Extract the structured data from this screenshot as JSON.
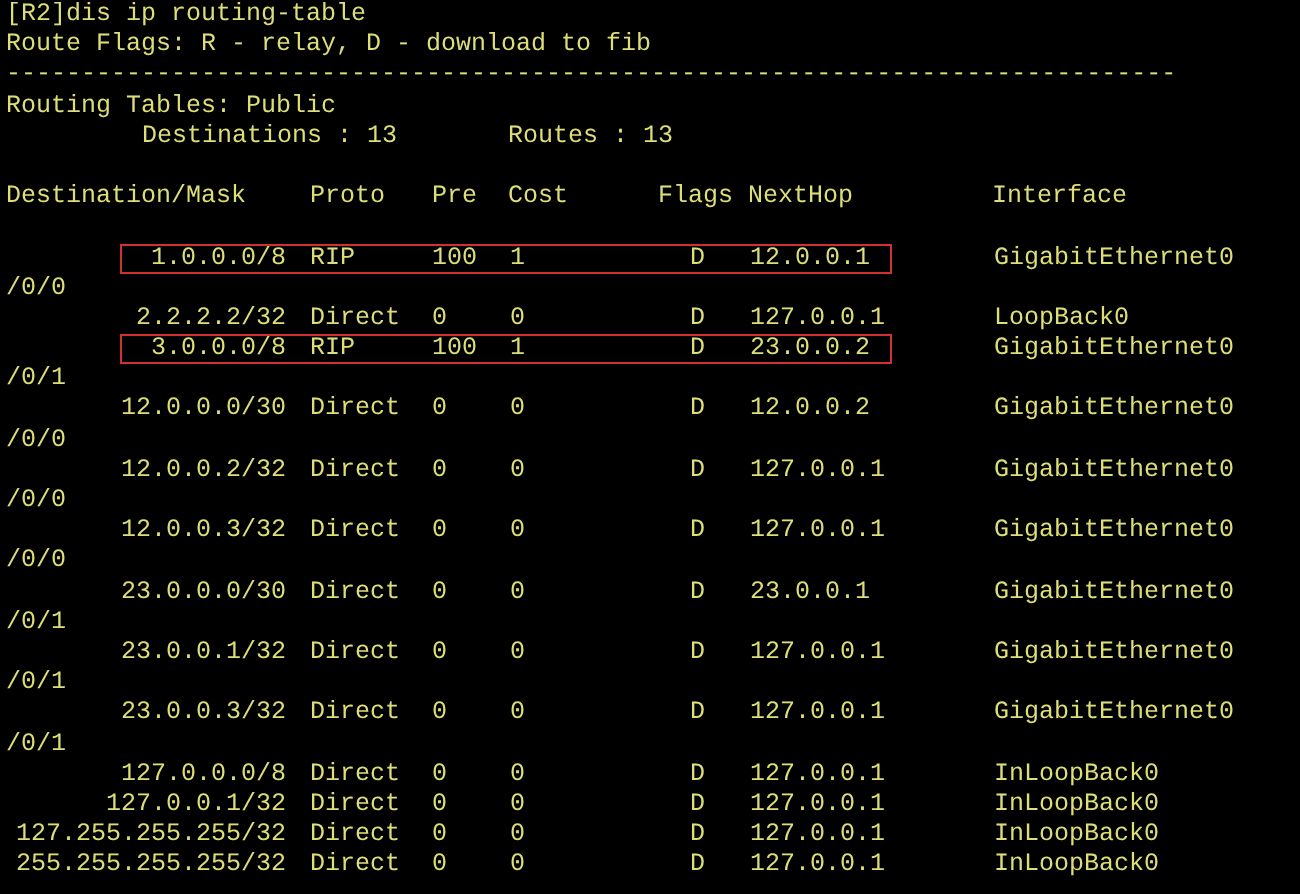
{
  "terminal": {
    "command": "[R2]dis ip routing-table",
    "flags_legend": "Route Flags: R - relay, D - download to fib",
    "separator": "------------------------------------------------------------------------------",
    "table_name": "Routing Tables: Public",
    "destinations": "Destinations : 13",
    "routes": "Routes : 13"
  },
  "columns": [
    "Destination/Mask",
    "Proto",
    "Pre",
    "Cost",
    "Flags",
    "NextHop",
    "Interface"
  ],
  "rows": [
    {
      "destination": "1.0.0.0/8",
      "proto": "RIP",
      "pre": "100",
      "cost": "1",
      "flags": "D",
      "nexthop": "12.0.0.1",
      "interface": "GigabitEthernet0",
      "interface_wrap": "/0/0",
      "highlighted": true
    },
    {
      "destination": "2.2.2.2/32",
      "proto": "Direct",
      "pre": "0",
      "cost": "0",
      "flags": "D",
      "nexthop": "127.0.0.1",
      "interface": "LoopBack0",
      "highlighted": false
    },
    {
      "destination": "3.0.0.0/8",
      "proto": "RIP",
      "pre": "100",
      "cost": "1",
      "flags": "D",
      "nexthop": "23.0.0.2",
      "interface": "GigabitEthernet0",
      "interface_wrap": "/0/1",
      "highlighted": true
    },
    {
      "destination": "12.0.0.0/30",
      "proto": "Direct",
      "pre": "0",
      "cost": "0",
      "flags": "D",
      "nexthop": "12.0.0.2",
      "interface": "GigabitEthernet0",
      "interface_wrap": "/0/0",
      "highlighted": false
    },
    {
      "destination": "12.0.0.2/32",
      "proto": "Direct",
      "pre": "0",
      "cost": "0",
      "flags": "D",
      "nexthop": "127.0.0.1",
      "interface": "GigabitEthernet0",
      "interface_wrap": "/0/0",
      "highlighted": false
    },
    {
      "destination": "12.0.0.3/32",
      "proto": "Direct",
      "pre": "0",
      "cost": "0",
      "flags": "D",
      "nexthop": "127.0.0.1",
      "interface": "GigabitEthernet0",
      "interface_wrap": "/0/0",
      "highlighted": false
    },
    {
      "destination": "23.0.0.0/30",
      "proto": "Direct",
      "pre": "0",
      "cost": "0",
      "flags": "D",
      "nexthop": "23.0.0.1",
      "interface": "GigabitEthernet0",
      "interface_wrap": "/0/1",
      "highlighted": false
    },
    {
      "destination": "23.0.0.1/32",
      "proto": "Direct",
      "pre": "0",
      "cost": "0",
      "flags": "D",
      "nexthop": "127.0.0.1",
      "interface": "GigabitEthernet0",
      "interface_wrap": "/0/1",
      "highlighted": false
    },
    {
      "destination": "23.0.0.3/32",
      "proto": "Direct",
      "pre": "0",
      "cost": "0",
      "flags": "D",
      "nexthop": "127.0.0.1",
      "interface": "GigabitEthernet0",
      "interface_wrap": "/0/1",
      "highlighted": false
    },
    {
      "destination": "127.0.0.0/8",
      "proto": "Direct",
      "pre": "0",
      "cost": "0",
      "flags": "D",
      "nexthop": "127.0.0.1",
      "interface": "InLoopBack0",
      "highlighted": false
    },
    {
      "destination": "127.0.0.1/32",
      "proto": "Direct",
      "pre": "0",
      "cost": "0",
      "flags": "D",
      "nexthop": "127.0.0.1",
      "interface": "InLoopBack0",
      "highlighted": false
    },
    {
      "destination": "127.255.255.255/32",
      "proto": "Direct",
      "pre": "0",
      "cost": "0",
      "flags": "D",
      "nexthop": "127.0.0.1",
      "interface": "InLoopBack0",
      "highlighted": false
    },
    {
      "destination": "255.255.255.255/32",
      "proto": "Direct",
      "pre": "0",
      "cost": "0",
      "flags": "D",
      "nexthop": "127.0.0.1",
      "interface": "InLoopBack0",
      "highlighted": false
    }
  ]
}
